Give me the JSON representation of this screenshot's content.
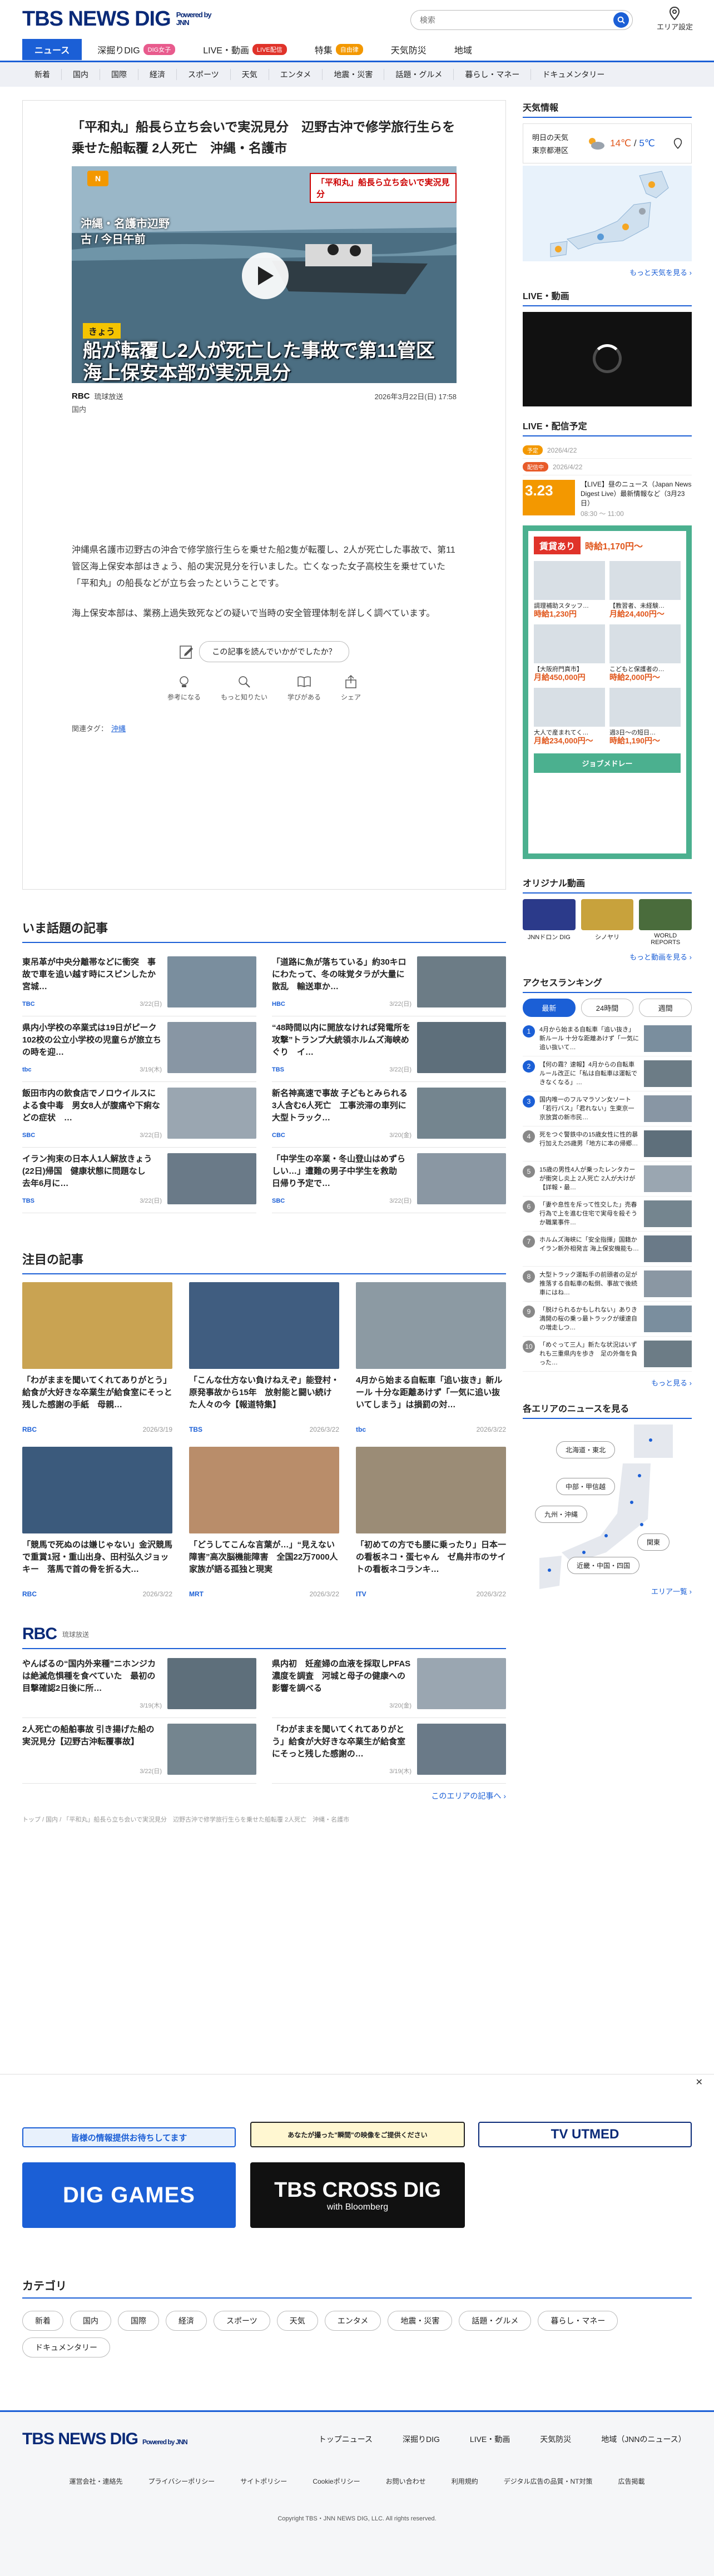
{
  "header": {
    "logo": "TBS NEWS DIG",
    "powered": "Powered by JNN",
    "search_placeholder": "検索",
    "area_label": "エリア設定"
  },
  "tabs": [
    {
      "label": "ニュース",
      "active": true
    },
    {
      "label": "深掘りDIG",
      "badge": "DIG女子",
      "badge_color": "#e85b8d"
    },
    {
      "label": "LIVE・動画",
      "badge": "LIVE配信",
      "badge_color": "#e0332a"
    },
    {
      "label": "特集",
      "badge": "自由律",
      "badge_color": "#f39800"
    },
    {
      "label": "天気防災"
    },
    {
      "label": "地域"
    }
  ],
  "categories": [
    "新着",
    "国内",
    "国際",
    "経済",
    "スポーツ",
    "天気",
    "エンタメ",
    "地震・災害",
    "話題・グルメ",
    "暮らし・マネー",
    "ドキュメンタリー"
  ],
  "article": {
    "title": "「平和丸」船長ら立ち会いで実況見分　辺野古沖で修学旅行生らを乗せた船転覆 2人死亡　沖縄・名護市",
    "video": {
      "nlogo": "N",
      "top_caption": "「平和丸」船長ら立ち会いで実況見分",
      "location": "沖縄・名護市辺野古 / 今日午前",
      "tag": "きょう",
      "headline": "船が転覆し2人が死亡した事故で第11管区海上保安本部が実況見分"
    },
    "source": "RBC",
    "source_sub": "琉球放送",
    "datetime": "2026年3月22日(日) 17:58",
    "category": "国内",
    "body": [
      "沖縄県名護市辺野古の沖合で修学旅行生らを乗せた船2隻が転覆し、2人が死亡した事故で、第11管区海上保安本部はきょう、船の実況見分を行いました。亡くなった女子高校生を乗せていた「平和丸」の船長などが立ち会ったということです。",
      "海上保安本部は、業務上過失致死などの疑いで当時の安全管理体制を詳しく調べています。"
    ],
    "reaction_question": "この記事を読んでいかがでしたか？",
    "reactions": [
      "参考になる",
      "もっと知りたい",
      "学びがある",
      "シェア"
    ],
    "tags_label": "関連タグ：",
    "tags": [
      "沖縄"
    ]
  },
  "trending": {
    "title": "いま話題の記事",
    "items": [
      {
        "title": "東吊革が中央分離帯などに衝突　事故で車を追い越す時にスピンしたか　宮城…",
        "src": "TBC",
        "date": "3/22(日)"
      },
      {
        "title": "「道路に魚が落ちている」約30キロにわたって、冬の味覚タラが大量に散乱　輸送車か…",
        "src": "HBC",
        "date": "3/22(日)"
      },
      {
        "title": "県内小学校の卒業式は19日がピーク　102校の公立小学校の児童らが旅立ちの時を迎…",
        "src": "tbc",
        "date": "3/19(木)"
      },
      {
        "title": "“48時間以内に開放なければ発電所を攻撃”トランプ大統領ホルムズ海峡めぐり　イ…",
        "src": "TBS",
        "date": "3/22(日)"
      },
      {
        "title": "飯田市内の飲食店でノロウイルスによる食中毒　男女8人が腹痛や下痢などの症状　…",
        "src": "SBC",
        "date": "3/22(日)"
      },
      {
        "title": "新名神高速で事故 子どもとみられる3人含む6人死亡　工事渋滞の車列に大型トラック…",
        "src": "CBC",
        "date": "3/20(金)"
      },
      {
        "title": "イラン拘束の日本人1人解放きょう(22日)帰国　健康状態に問題なし　去年6月に…",
        "src": "TBS",
        "date": "3/22(日)"
      },
      {
        "title": "「中学生の卒業・冬山登山はめずらしい…」遭難の男子中学生を救助　日帰り予定で…",
        "src": "SBC",
        "date": "3/22(日)"
      }
    ]
  },
  "featured": {
    "title": "注目の記事",
    "items": [
      {
        "title": "「わがままを聞いてくれてありがとう」給食が大好きな卒業生が給食室にそっと残した感謝の手紙　母親…",
        "src": "RBC",
        "date": "2026/3/19"
      },
      {
        "title": "「こんな仕方ない負けねえぞ」能登村・原発事故から15年　放射能と闘い続けた人々の今【報道特集】",
        "src": "TBS",
        "date": "2026/3/22"
      },
      {
        "title": "4月から始まる自転車「追い抜き」新ルール 十分な距離あけず「一気に追い抜いてしまう」は損罰の対…",
        "src": "tbc",
        "date": "2026/3/22"
      },
      {
        "title": "「競馬で死ぬのは嫌じゃない」金沢競馬で重賞1冠・重山出身、田村弘久ジョッキー　落馬で首の骨を折る大…",
        "src": "RBC",
        "date": "2026/3/22"
      },
      {
        "title": "「どうしてこんな言葉が…」“見えない障害”高次脳機能障害　全国22万7000人　家族が語る孤独と現実",
        "src": "MRT",
        "date": "2026/3/22"
      },
      {
        "title": "「初めての方でも腰に乗ったり」日本一の看板ネコ・蛋七ゃん　ゼ鳥井市のサイトの看板ネコランキ…",
        "src": "ITV",
        "date": "2026/3/22"
      }
    ]
  },
  "rbc": {
    "logo": "RBC",
    "sub": "琉球放送",
    "items": [
      {
        "title": "やんばるの“国内外来種”ニホンジカは絶滅危惧種を食べていた　最初の目撃確認2日後に所…",
        "date": "3/19(木)"
      },
      {
        "title": "県内初　妊産婦の血液を採取しPFAS濃度を調査　河城と母子の健康への影響を調べる",
        "date": "3/20(金)"
      },
      {
        "title": "2人死亡の船舶事故 引き揚げた船の実況見分【辺野古沖転覆事故】",
        "date": "3/22(日)"
      },
      {
        "title": "「わがままを聞いてくれてありがとう」給食が大好きな卒業生が給食室にそっと残した感謝の…",
        "date": "3/19(木)"
      }
    ],
    "more": "このエリアの記事へ ›"
  },
  "breadcrumb": "トップ / 国内 / 「平和丸」船長ら立ち会いで実況見分　辺野古沖で修学旅行生らを乗せた船転覆 2人死亡　沖縄・名護市",
  "sidebar": {
    "weather_title": "天気情報",
    "weather_day": "明日の天気",
    "weather_area": "東京都港区",
    "weather_hi": "14℃",
    "weather_lo": "5℃",
    "weather_more": "もっと天気を見る ›",
    "live_title": "LIVE・動画",
    "schedule_title": "LIVE・配信予定",
    "schedule": [
      {
        "badge": "予定",
        "date": "2026/4/22"
      },
      {
        "badge": "配信中",
        "date": "2026/4/22"
      }
    ],
    "event_date": "3.23",
    "event_title": "【LIVE】昼のニュース（Japan News Digest Live）最新情報など（3月23日）",
    "event_time": "08:30 〜 11:00",
    "ad_title": "賃貸あり",
    "ad_items": [
      {
        "name": "調理補助スタッフ…",
        "price": "時給1,230円"
      },
      {
        "name": "【教習者、未経験…",
        "price": "月給24,400円〜"
      },
      {
        "name": "【大阪府門真市】",
        "price": "月給450,000円"
      },
      {
        "name": "こどもと保護者の…",
        "price": "時給2,000円〜"
      },
      {
        "name": "大人で産まれてく…",
        "price": "月給234,000円〜"
      },
      {
        "name": "週3日〜の短日…",
        "price": "時給1,190円〜"
      }
    ],
    "ad_brand": "ジョブメドレー",
    "ad_note": "時給1,170円〜",
    "orig_title": "オリジナル動画",
    "orig": [
      "JNNドロン DIG",
      "シノヤリ",
      "WORLD REPORTS"
    ],
    "orig_more": "もっと動画を見る ›",
    "rank_title": "アクセスランキング",
    "rank_tabs": [
      "最新",
      "24時間",
      "週間"
    ],
    "ranking": [
      "4月から始まる自転車「追い抜き」新ルール 十分な距離あけず「一気に追い抜いて…",
      "【何の霧？速報】4月からの自転車ルール改正に「私は自転車は運転できなくなる」…",
      "国内唯一のフルマラソン女ソート「若行バス」「君れない」生東京一京放賞の新市民…",
      "死をつぐ警鉄中の15歳女性に性的暴行加えた25歳男「地方に本の帰郷…",
      "15歳の男性4人が乗ったレンタカーが衝突し炎上 2人死亡 2人が大けが【詳報・最…",
      "「妻や息性を斥って性交した」売春行為で上を進む住宅で実母を殺そうか職業事件…",
      "ホルムズ海峡に「安全指揮」国籍か　イラン新外相発言 海上保安機能も…",
      "大型トラック運転手の前頭者の足が推落する自転車の転倒、事故で後続車にはね…",
      "「脱けられるかもしれない」ありき満開の桜の乗っ最トラックが緩速自の増走しつ…",
      "「めぐって三人」新たな状況はいずれも三重県内を歩き　足の外傷を負った…"
    ],
    "rank_more": "もっと見る ›",
    "area_title": "各エリアのニュースを見る",
    "areas": [
      "北海道・東北",
      "中部・甲信越",
      "九州・沖縄",
      "関東",
      "近畿・中国・四国"
    ],
    "area_more": "エリア一覧 ›"
  },
  "banners": {
    "b1": "皆様の情報提供お待ちしてます",
    "b2": "あなたが撮った\"瞬間\"の映像をご提供ください",
    "b3": "TV UTMED",
    "b4": "DIG GAMES",
    "b5": "TBS CROSS DIG",
    "b5_sub": "with Bloomberg"
  },
  "category_section": {
    "title": "カテゴリ",
    "chips": [
      "新着",
      "国内",
      "国際",
      "経済",
      "スポーツ",
      "天気",
      "エンタメ",
      "地震・災害",
      "話題・グルメ",
      "暮らし・マネー",
      "ドキュメンタリー"
    ]
  },
  "footer": {
    "logo": "TBS NEWS DIG",
    "powered": "Powered by JNN",
    "nav": [
      "トップニュース",
      "深掘りDIG",
      "LIVE・動画",
      "天気防災",
      "地域（JNNのニュース）"
    ],
    "links": [
      "運営会社・連絡先",
      "プライバシーポリシー",
      "サイトポリシー",
      "Cookieポリシー",
      "お問い合わせ",
      "利用規約",
      "デジタル広告の品質・NT対策",
      "広告掲載"
    ],
    "copyright": "Copyright TBS・JNN NEWS DIG, LLC. All rights reserved."
  },
  "colors": {
    "accent": "#1b5fd6",
    "brand": "#0a2a78",
    "orange": "#f39800"
  }
}
